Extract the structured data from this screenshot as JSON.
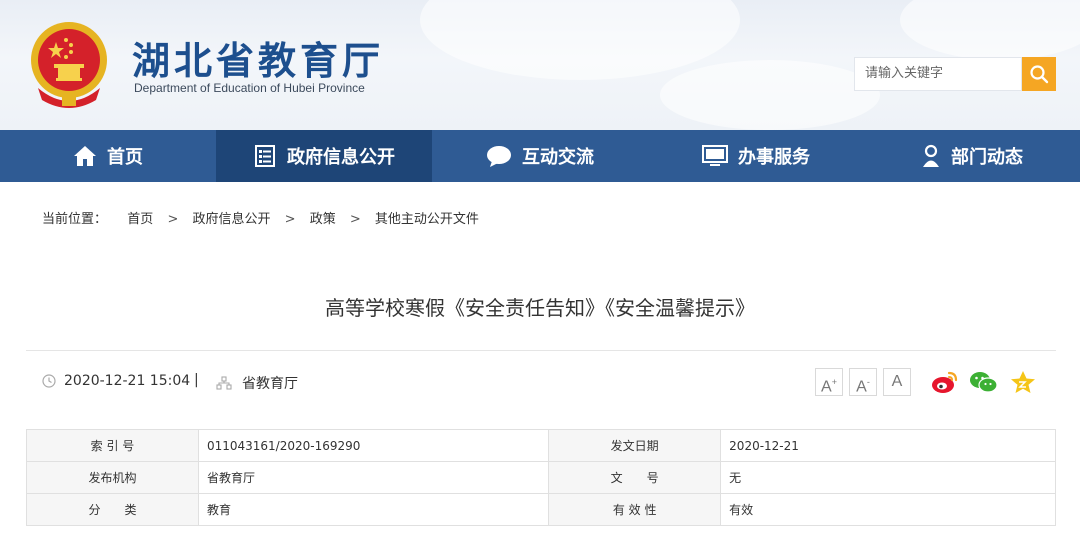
{
  "header": {
    "title": "湖北省教育厅",
    "subtitle": "Department of Education of Hubei Province",
    "search_placeholder": "请输入关键字"
  },
  "nav": [
    {
      "label": "首页",
      "icon": "home-icon"
    },
    {
      "label": "政府信息公开",
      "icon": "document-list-icon",
      "active": true
    },
    {
      "label": "互动交流",
      "icon": "chat-bubble-icon"
    },
    {
      "label": "办事服务",
      "icon": "monitor-icon"
    },
    {
      "label": "部门动态",
      "icon": "person-icon"
    }
  ],
  "breadcrumb": {
    "prefix": "当前位置：",
    "items": [
      "首页",
      "政府信息公开",
      "政策",
      "其他主动公开文件"
    ],
    "sep": ">"
  },
  "article": {
    "title": "高等学校寒假《安全责任告知》《安全温馨提示》",
    "datetime": "2020-12-21 15:04",
    "divider": "|",
    "source": "省教育厅",
    "font_buttons": [
      "A",
      "A",
      "A"
    ],
    "font_marks": [
      "+",
      "-",
      ""
    ],
    "share_icons": [
      "weibo-icon",
      "wechat-icon",
      "favorite-star-icon"
    ]
  },
  "info_table": {
    "rows": [
      {
        "l1": "索 引 号",
        "v1": "011043161/2020-169290",
        "l2": "发文日期",
        "v2": "2020-12-21"
      },
      {
        "l1": "发布机构",
        "v1": "省教育厅",
        "l2": "文　　号",
        "v2": "无"
      },
      {
        "l1": "分　　类",
        "v1": "教育",
        "l2": "有 效 性",
        "v2": "有效"
      }
    ]
  },
  "colors": {
    "brand_blue": "#2f5b94",
    "nav_active": "#1e4577",
    "accent_orange": "#f5a623",
    "title_blue": "#1d4f8e"
  }
}
